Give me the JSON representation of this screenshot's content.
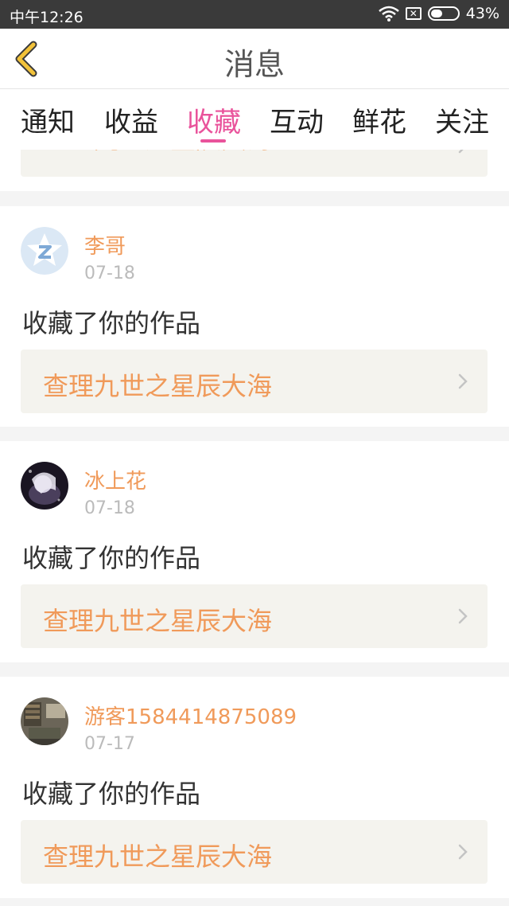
{
  "status_bar": {
    "time": "中午12:26",
    "battery": "43%",
    "sim_glyph": "✕"
  },
  "header": {
    "title": "消息",
    "back_icon": "chevron-left-icon"
  },
  "tabs": [
    {
      "label": "通知",
      "active": false
    },
    {
      "label": "收益",
      "active": false
    },
    {
      "label": "收藏",
      "active": true
    },
    {
      "label": "互动",
      "active": false
    },
    {
      "label": "鲜花",
      "active": false
    },
    {
      "label": "关注",
      "active": false
    }
  ],
  "partial_item": {
    "work_title": "查理九世之星辰大海"
  },
  "messages": [
    {
      "user": "李哥",
      "date": "07-18",
      "action": "收藏了你的作品",
      "work_title": "查理九世之星辰大海",
      "avatar": "default-logo-avatar"
    },
    {
      "user": "冰上花",
      "date": "07-18",
      "action": "收藏了你的作品",
      "work_title": "查理九世之星辰大海",
      "avatar": "photo-avatar-dark"
    },
    {
      "user": "游客1584414875089",
      "date": "07-17",
      "action": "收藏了你的作品",
      "work_title": "查理九世之星辰大海",
      "avatar": "photo-avatar-room"
    }
  ],
  "colors": {
    "accent": "#e9539b",
    "highlight": "#f09a5a",
    "back_arrow": "#f2c23a",
    "status_bar": "#3a3a3a"
  }
}
